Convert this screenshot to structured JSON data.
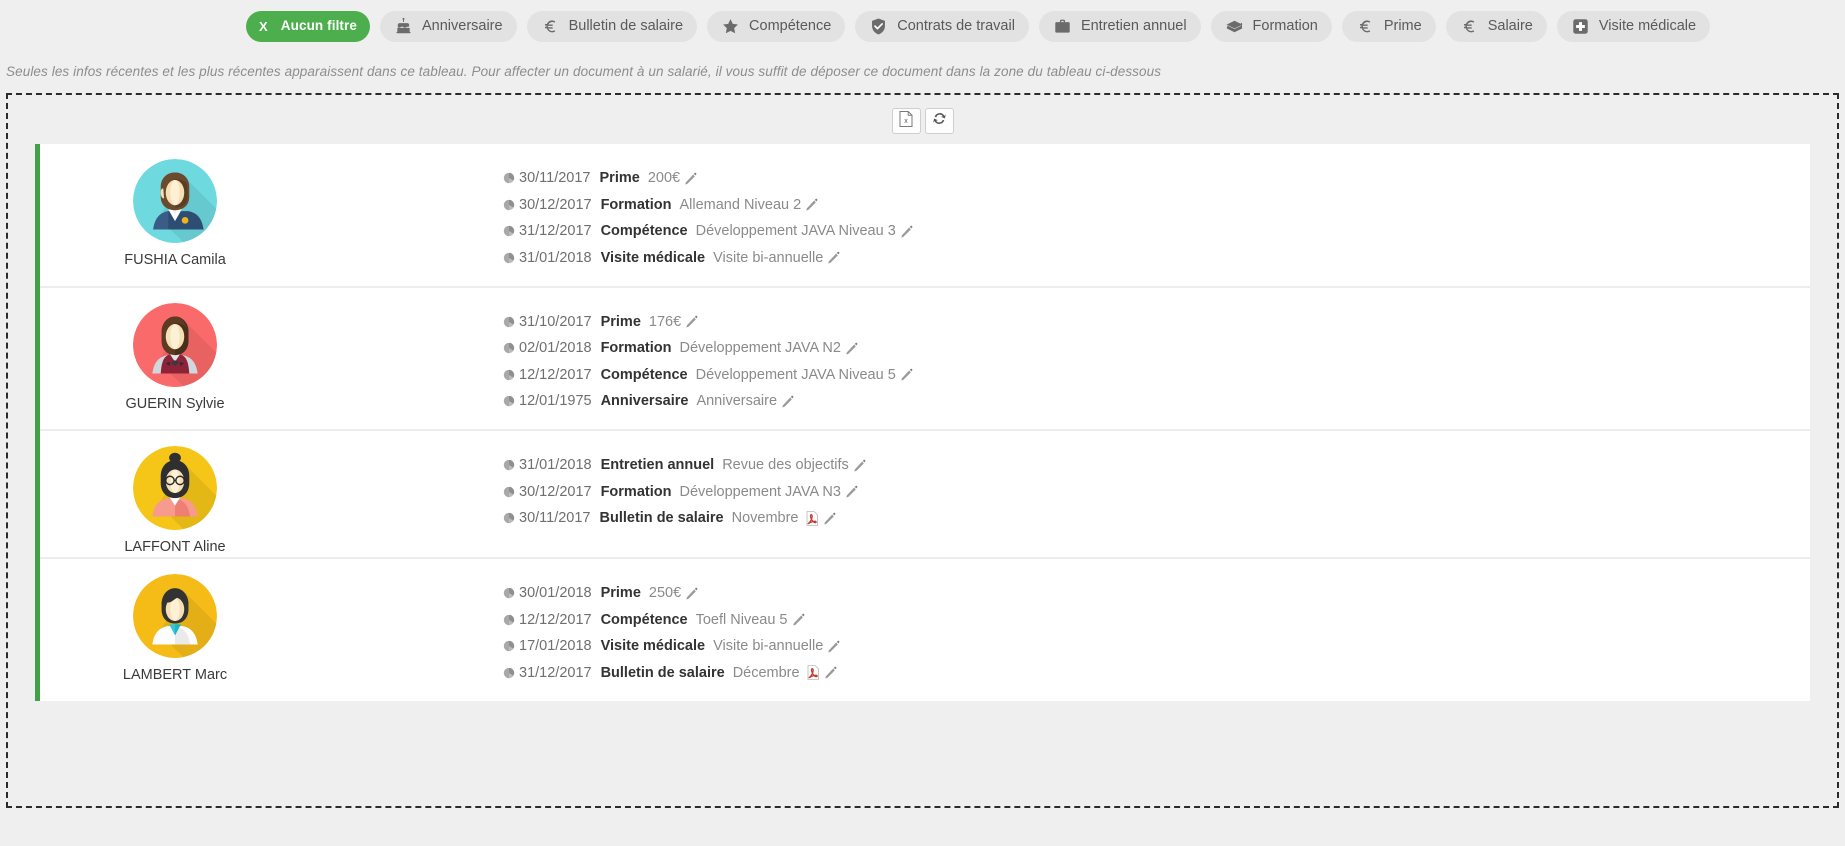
{
  "filters": [
    {
      "label": "Aucun filtre",
      "icon": "close-x-icon",
      "active": true
    },
    {
      "label": "Anniversaire",
      "icon": "cake-icon",
      "active": false
    },
    {
      "label": "Bulletin de salaire",
      "icon": "euro-icon",
      "active": false
    },
    {
      "label": "Compétence",
      "icon": "star-icon",
      "active": false
    },
    {
      "label": "Contrats de travail",
      "icon": "shield-check-icon",
      "active": false
    },
    {
      "label": "Entretien annuel",
      "icon": "briefcase-icon",
      "active": false
    },
    {
      "label": "Formation",
      "icon": "graduation-cap-icon",
      "active": false
    },
    {
      "label": "Prime",
      "icon": "euro-icon",
      "active": false
    },
    {
      "label": "Salaire",
      "icon": "euro-icon",
      "active": false
    },
    {
      "label": "Visite médicale",
      "icon": "medical-cross-icon",
      "active": false
    }
  ],
  "note": "Seules les infos récentes et les plus récentes apparaissent dans ce tableau.  Pour affecter un document à un salarié, il vous suffit de déposer ce document dans la zone du tableau ci-dessous",
  "toolbar": {
    "export_excel": "excel-export-icon",
    "refresh": "refresh-icon"
  },
  "colors": {
    "accent_green": "#4cae4c",
    "row_bar_green": "#43a047",
    "chip_bg": "#e2e2e2",
    "page_bg": "#efefef"
  },
  "employees": [
    {
      "name": "FUSHIA Camila",
      "avatar": "avatar-flight-attendant",
      "avatar_bg": "#6fd9e0",
      "entries": [
        {
          "date": "30/11/2017",
          "type": "Prime",
          "value": "200€",
          "has_pdf": false
        },
        {
          "date": "30/12/2017",
          "type": "Formation",
          "value": "Allemand Niveau 2",
          "has_pdf": false
        },
        {
          "date": "31/12/2017",
          "type": "Compétence",
          "value": "Développement JAVA Niveau 3",
          "has_pdf": false
        },
        {
          "date": "31/01/2018",
          "type": "Visite médicale",
          "value": "Visite bi-annuelle",
          "has_pdf": false
        }
      ]
    },
    {
      "name": "GUERIN Sylvie",
      "avatar": "avatar-waitress",
      "avatar_bg": "#fa6a6a",
      "entries": [
        {
          "date": "31/10/2017",
          "type": "Prime",
          "value": "176€",
          "has_pdf": false
        },
        {
          "date": "02/01/2018",
          "type": "Formation",
          "value": "Développement JAVA N2",
          "has_pdf": false
        },
        {
          "date": "12/12/2017",
          "type": "Compétence",
          "value": "Développement JAVA Niveau 5",
          "has_pdf": false
        },
        {
          "date": "12/01/1975",
          "type": "Anniversaire",
          "value": "Anniversaire",
          "has_pdf": false
        }
      ]
    },
    {
      "name": "LAFFONT Aline",
      "avatar": "avatar-glasses-woman",
      "avatar_bg": "#f5c518",
      "entries": [
        {
          "date": "31/01/2018",
          "type": "Entretien annuel",
          "value": "Revue des objectifs",
          "has_pdf": false
        },
        {
          "date": "30/12/2017",
          "type": "Formation",
          "value": "Développement JAVA N3",
          "has_pdf": false
        },
        {
          "date": "30/11/2017",
          "type": "Bulletin de salaire",
          "value": "Novembre",
          "has_pdf": true
        }
      ]
    },
    {
      "name": "LAMBERT Marc",
      "avatar": "avatar-doctor",
      "avatar_bg": "#f5bc18",
      "entries": [
        {
          "date": "30/01/2018",
          "type": "Prime",
          "value": "250€",
          "has_pdf": false
        },
        {
          "date": "12/12/2017",
          "type": "Compétence",
          "value": "Toefl Niveau 5",
          "has_pdf": false
        },
        {
          "date": "17/01/2018",
          "type": "Visite médicale",
          "value": "Visite bi-annuelle",
          "has_pdf": false
        },
        {
          "date": "31/12/2017",
          "type": "Bulletin de salaire",
          "value": "Décembre",
          "has_pdf": true
        }
      ]
    }
  ]
}
